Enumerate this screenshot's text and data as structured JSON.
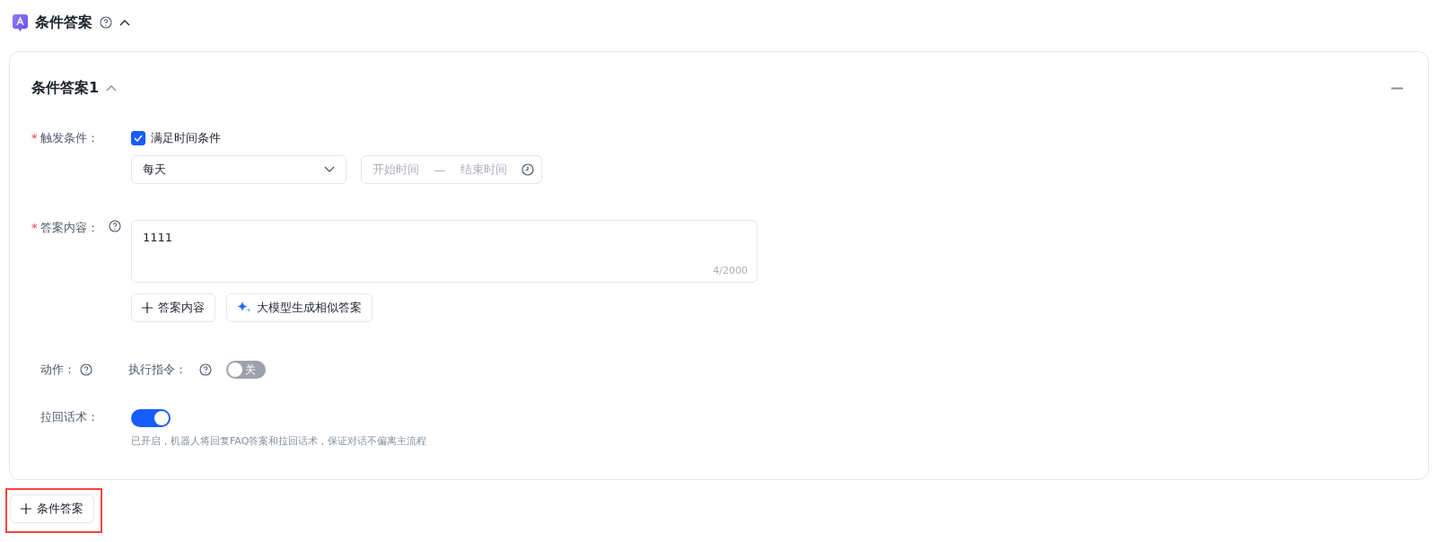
{
  "header": {
    "title": "条件答案",
    "expanded": true
  },
  "condition_answers": [
    {
      "title": "条件答案1",
      "expanded": true,
      "trigger": {
        "label": "触发条件：",
        "required_mark": "*",
        "checkbox": {
          "label": "满足时间条件",
          "checked": true
        },
        "frequency": {
          "value": "每天"
        },
        "time_range": {
          "start_placeholder": "开始时间",
          "separator": "—",
          "end_placeholder": "结束时间"
        }
      },
      "answer": {
        "label": "答案内容：",
        "required_mark": "*",
        "value": "1111",
        "counter": "4/2000",
        "buttons": [
          {
            "kind": "add",
            "label": "答案内容"
          },
          {
            "kind": "ai",
            "label": "大模型生成相似答案"
          }
        ]
      },
      "action": {
        "label": "动作：",
        "command": {
          "label": "执行指令：",
          "on": false,
          "text": "关"
        }
      },
      "pullback": {
        "label": "拉回话术：",
        "on": true,
        "hint": "已开启，机器人将回复FAQ答案和拉回话术，保证对话不偏离主流程"
      }
    }
  ],
  "add_button": {
    "label": "条件答案",
    "highlighted": true
  }
}
